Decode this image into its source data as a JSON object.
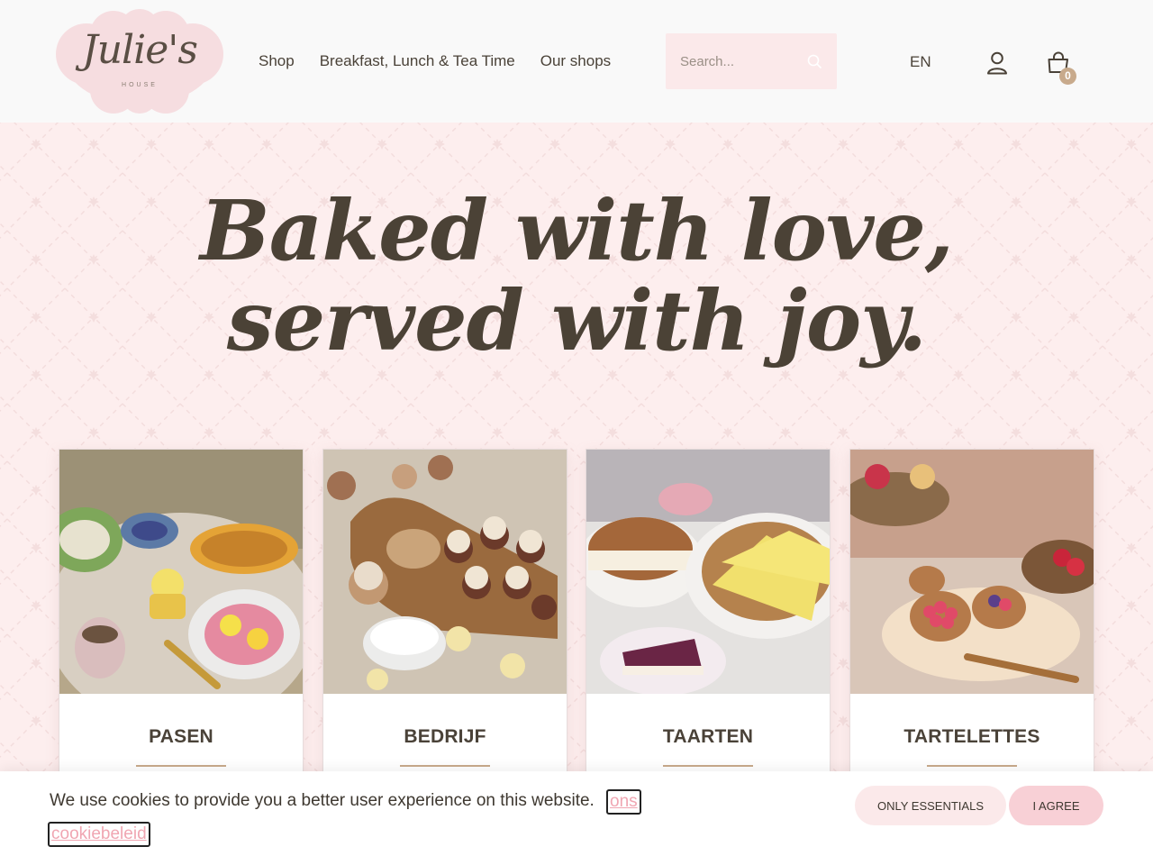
{
  "header": {
    "logo": {
      "script": "Julie's",
      "sub": "HOUSE"
    },
    "nav": [
      {
        "label": "Shop"
      },
      {
        "label": "Breakfast, Lunch & Tea Time"
      },
      {
        "label": "Our shops"
      }
    ],
    "search": {
      "placeholder": "Search..."
    },
    "language": "EN",
    "cart_count": "0"
  },
  "hero": {
    "headline_line1": "Baked with love,",
    "headline_line2": "served with joy."
  },
  "categories": [
    {
      "title": "PASEN"
    },
    {
      "title": "BEDRIJF"
    },
    {
      "title": "TAARTEN"
    },
    {
      "title": "TARTELETTES"
    }
  ],
  "cookie": {
    "text": "We use cookies to provide you a better user experience on this website.",
    "link_part1": "ons",
    "link_part2": "cookiebeleid",
    "btn_essentials": "Only essentials",
    "btn_agree": "I agree"
  },
  "colors": {
    "header_bg": "#f9f9f9",
    "hero_bg": "#fdeeee",
    "accent_pink": "#f8d0d6",
    "accent_gold": "#c8aa8c",
    "text": "#4a4238"
  },
  "icons": [
    "search-icon",
    "user-icon",
    "cart-icon"
  ]
}
